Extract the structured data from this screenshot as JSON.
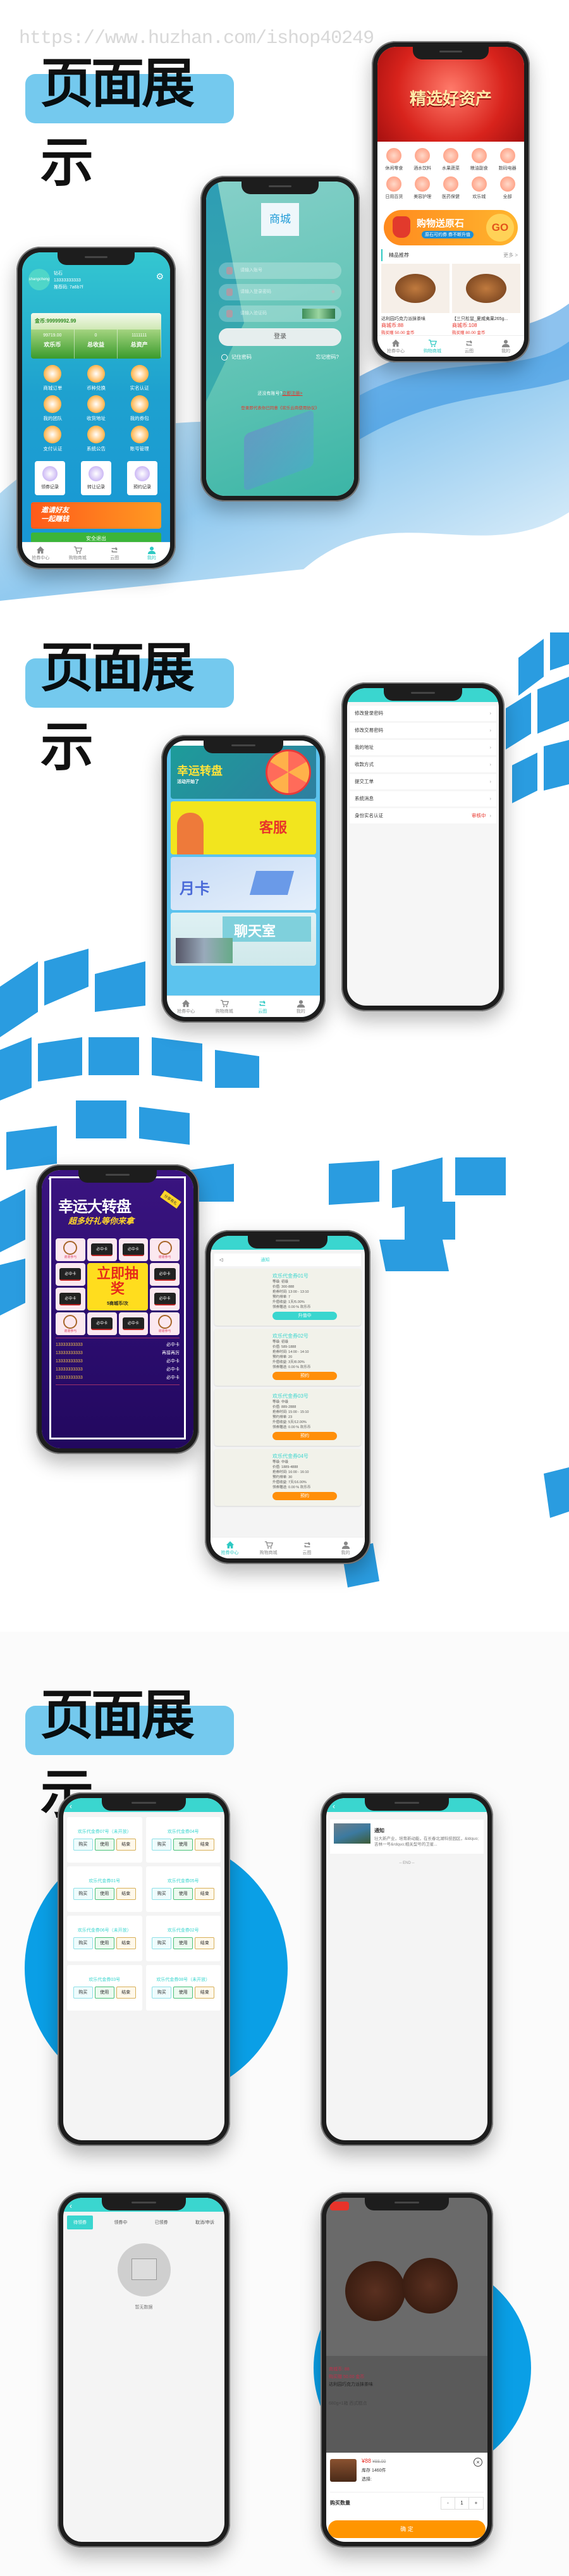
{
  "watermark": "https://www.huzhan.com/ishop40249",
  "section_title": "页面展示",
  "tabbar": [
    "抢券中心",
    "购物商城",
    "云图",
    "我的"
  ],
  "colors": {
    "accent": "#3ad6cf",
    "brand_blue": "#74c9ee",
    "orange": "#ff9500",
    "price_red": "#e8332a"
  },
  "mall": {
    "banner_text": "精选好资产",
    "categories": [
      "休闲零食",
      "酒水饮料",
      "水果蔬菜",
      "粮油副食",
      "数码电器",
      "日用百货",
      "美容护理",
      "医药保健",
      "欢乐城",
      "全部"
    ],
    "promo": {
      "title": "购物送原石",
      "subtitle": "原石可约券 券不断升值",
      "go": "GO"
    },
    "section": "精品推荐",
    "more": "更多 >",
    "products": [
      {
        "name": "达利园巧克力派抹茶味",
        "price": "商城币:88",
        "gift": "购买赠 50.00 金币"
      },
      {
        "name": "【三只松鼠_夏威夷果265g...",
        "price": "商城币:108",
        "gift": "购买赠 80.00 金币"
      }
    ]
  },
  "login": {
    "logo": "商城",
    "account_placeholder": "请输入账号",
    "password_placeholder": "请输入登录密码",
    "captcha_placeholder": "请输入验证码",
    "login_button": "登录",
    "remember": "记住密码",
    "forgot": "忘记密码?",
    "no_account": "还没有账号?",
    "register": "立即注册>",
    "agreement": "登录即代表你已同意《欢乐云商使用协议》"
  },
  "user": {
    "avatar_text": "shangcheng",
    "level": "钻石",
    "phone": "13333333333",
    "referral": "推荐码: 7a6b7f",
    "gold": "金币:99999992.99",
    "stats": [
      {
        "value": "99719.00",
        "label": "欢乐币"
      },
      {
        "value": "0",
        "label": "总收益"
      },
      {
        "value": "1111111",
        "label": "总资产"
      }
    ],
    "menu": [
      "商城订单",
      "币种兑换",
      "实名认证",
      "我的团队",
      "收货地址",
      "我的券包",
      "支付认证",
      "系统公告",
      "账号管理"
    ],
    "records": [
      "领券记录",
      "转让记录",
      "预约记录"
    ],
    "invite": [
      "邀请好友",
      "一起赚钱"
    ],
    "logout": "安全退出"
  },
  "banners": {
    "wheel_title": "幸运转盘",
    "wheel_sub": "活动开始了",
    "service": "客服",
    "monthly": "月卡",
    "chat": "聊天室"
  },
  "settings": {
    "items": [
      {
        "label": "修改登录密码"
      },
      {
        "label": "修改交易密码"
      },
      {
        "label": "我的地址"
      },
      {
        "label": "收款方式"
      },
      {
        "label": "提交工单"
      },
      {
        "label": "系统消息"
      },
      {
        "label": "身份实名认证",
        "status": "审核中"
      }
    ]
  },
  "lottery": {
    "title": "幸运大转盘",
    "subtitle": "超多好礼等你来拿",
    "share": "分享有礼",
    "thanks": "谢谢参与",
    "card": "必中卡",
    "draw": "立即抽奖",
    "cost": "5商城币/次",
    "winners": [
      {
        "phone": "13333333333",
        "prize": "必中卡"
      },
      {
        "phone": "13333333333",
        "prize": "再接再厉"
      },
      {
        "phone": "13333333333",
        "prize": "必中卡"
      },
      {
        "phone": "13333333333",
        "prize": "必中卡"
      },
      {
        "phone": "13333333333",
        "prize": "必中卡"
      }
    ]
  },
  "coupons": {
    "notice": "通知",
    "items": [
      {
        "name": "欢乐代金券01号",
        "level": "等级:   初级",
        "value": "价值:   300-888",
        "time": "抢券时间:   13:00 - 13:10",
        "queue": "预约排单:   7",
        "yield": "升值收益:   1天/5.00%",
        "bonus": "领券赠送:   0.00 % 欢乐币",
        "button": "升值中"
      },
      {
        "name": "欢乐代金券02号",
        "level": "等级:   初级",
        "value": "价值:   589-1888",
        "time": "抢券时间:   14:00 - 14:10",
        "queue": "预约排单:   20",
        "yield": "升值收益:   3天/8.00%",
        "bonus": "领券赠送:   0.00 % 欢乐币",
        "button": "预约"
      },
      {
        "name": "欢乐代金券03号",
        "level": "等级:   中级",
        "value": "价值:   889-2888",
        "time": "抢券时间:   15:00 - 15:10",
        "queue": "预约排单:   23",
        "yield": "升值收益:   5天/12.00%",
        "bonus": "领券赠送:   0.00 % 欢乐币",
        "button": "预约"
      },
      {
        "name": "欢乐代金券04号",
        "level": "等级:   中级",
        "value": "价值:   1889-4888",
        "time": "抢券时间:   16:00 - 16:10",
        "queue": "预约排单:   30",
        "yield": "升值收益:   7天/16.00%",
        "bonus": "领券赠送:   0.00 % 欢乐币",
        "button": "预约"
      }
    ]
  },
  "coupon_grid": {
    "buttons": [
      "购买",
      "使用",
      "结束"
    ],
    "items": [
      "欢乐代金券07号（未开放）",
      "欢乐代金券04号",
      "欢乐代金券01号",
      "欢乐代金券05号",
      "欢乐代金券06号（未开放）",
      "欢乐代金券02号",
      "欢乐代金券03号",
      "欢乐代金券08号（未开放）"
    ]
  },
  "news": {
    "title": "通知",
    "desc": "壮大新产业，培育新动能，在长春北湖科技园区，&ldquo;吉林一号&rdquo;相关型号的卫星...",
    "end": "-- END --"
  },
  "coupon_tabs": {
    "tabs": [
      "待领券",
      "领券中",
      "已领券",
      "取消/申诉"
    ],
    "empty": "暂无数据"
  },
  "product": {
    "price": "商城币: 88",
    "gift": "购买赠 50.00 金币",
    "name": "达利园巧克力派抹茶味",
    "spec": "680g×1箱   西式糕点",
    "sheet_price": "¥88",
    "original_price": "¥88.00",
    "stock": "库存 1460件",
    "select": "选择:",
    "qty_label": "购买数量",
    "minus": "-",
    "qty": "1",
    "plus": "+",
    "confirm": "确 定"
  }
}
